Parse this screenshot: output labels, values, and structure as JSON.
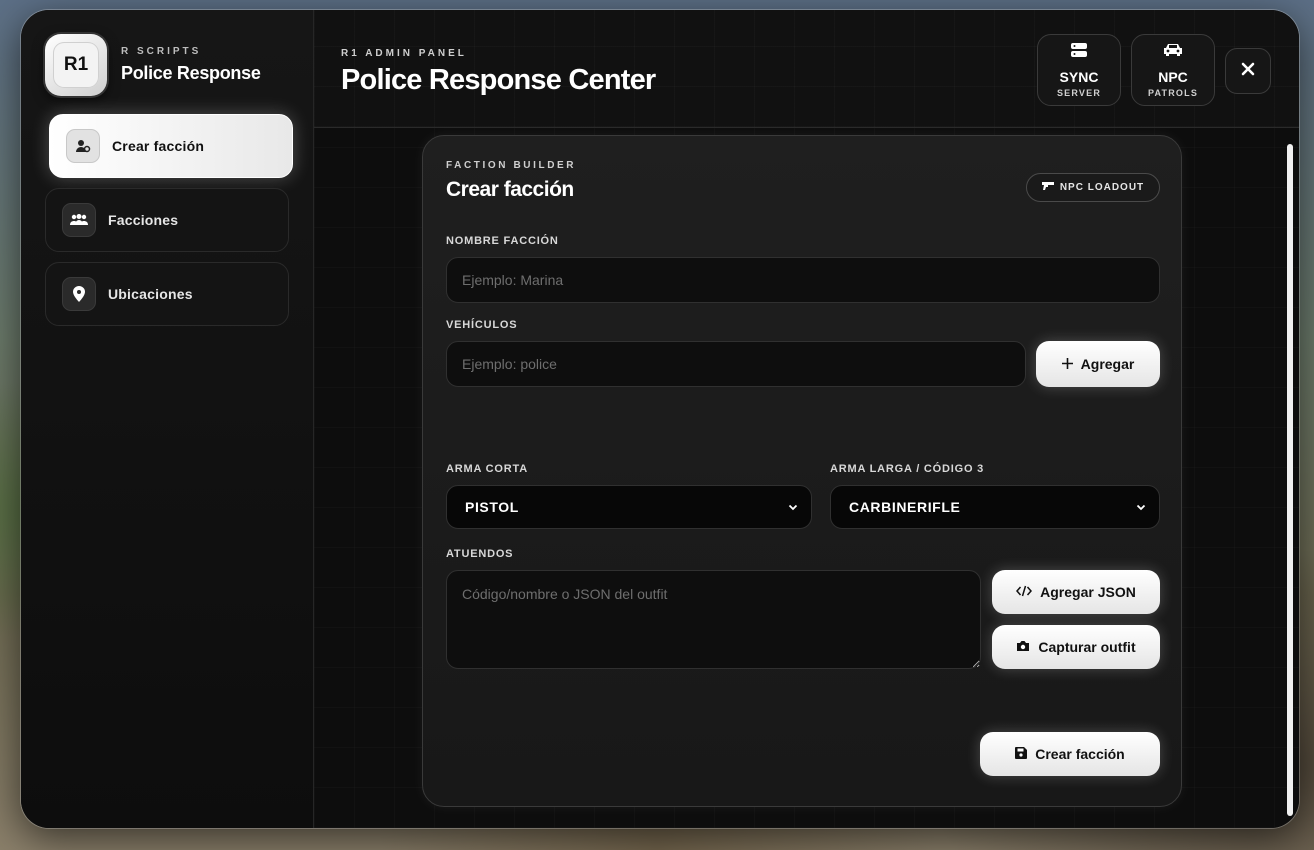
{
  "brand": {
    "logo_text": "R1",
    "subtitle": "R SCRIPTS",
    "title": "Police Response"
  },
  "sidebar": {
    "items": [
      {
        "label": "Crear facción",
        "icon": "user-cog-icon",
        "active": true
      },
      {
        "label": "Facciones",
        "icon": "users-icon",
        "active": false
      },
      {
        "label": "Ubicaciones",
        "icon": "map-pin-icon",
        "active": false
      }
    ]
  },
  "header": {
    "subtitle": "R1 ADMIN PANEL",
    "title": "Police Response Center",
    "buttons": [
      {
        "main": "SYNC",
        "sub": "SERVER",
        "icon": "server-icon"
      },
      {
        "main": "NPC",
        "sub": "PATROLS",
        "icon": "car-icon"
      }
    ],
    "close_icon": "close-icon"
  },
  "card": {
    "subtitle": "FACTION BUILDER",
    "title": "Crear facción",
    "loadout_pill": "NPC LOADOUT",
    "faction_name": {
      "label": "NOMBRE FACCIÓN",
      "placeholder": "Ejemplo: Marina",
      "value": ""
    },
    "vehicles": {
      "label": "VEHÍCULOS",
      "placeholder": "Ejemplo: police",
      "value": "",
      "add_label": "Agregar"
    },
    "short_weapon": {
      "label": "ARMA CORTA",
      "selected": "PISTOL"
    },
    "long_weapon": {
      "label": "ARMA LARGA / CÓDIGO 3",
      "selected": "CARBINERIFLE"
    },
    "outfits": {
      "label": "ATUENDOS",
      "placeholder": "Código/nombre o JSON del outfit",
      "value": "",
      "add_json_label": "Agregar JSON",
      "capture_label": "Capturar outfit"
    },
    "submit_label": "Crear facción"
  },
  "colors": {
    "panel_bg": "#0b0b0b",
    "accent_white": "#ffffff",
    "card_bg": "#1c1c1c"
  }
}
